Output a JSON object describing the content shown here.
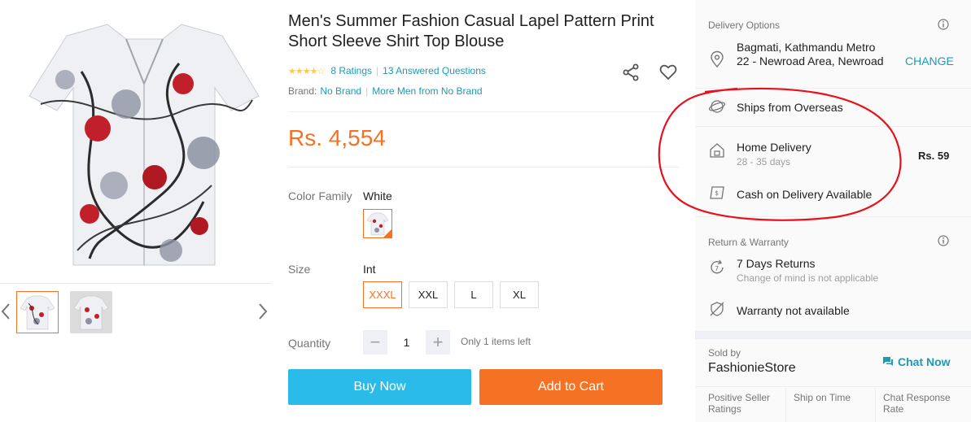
{
  "product": {
    "title": "Men's Summer Fashion Casual Lapel Pattern Print Short Sleeve Shirt Top Blouse",
    "ratings_count": "8 Ratings",
    "answered_questions": "13 Answered Questions",
    "brand_label": "Brand:",
    "brand_value": "No Brand",
    "more_from_brand": "More Men from No Brand",
    "price": "Rs. 4,554"
  },
  "options": {
    "color_label": "Color Family",
    "color_value": "White",
    "size_label": "Size",
    "size_value": "Int",
    "sizes": [
      "XXXL",
      "XXL",
      "L",
      "XL"
    ],
    "selected_size": "XXXL",
    "quantity_label": "Quantity",
    "quantity_value": "1",
    "stock_note": "Only 1 items left"
  },
  "actions": {
    "buy_now": "Buy Now",
    "add_to_cart": "Add to Cart"
  },
  "delivery": {
    "heading": "Delivery Options",
    "location": "Bagmati, Kathmandu Metro 22 - Newroad Area, Newroad",
    "change": "CHANGE",
    "ships_from": "Ships from Overseas",
    "home_delivery": "Home Delivery",
    "home_delivery_days": "28 - 35 days",
    "home_delivery_fee": "Rs. 59",
    "cod": "Cash on Delivery Available"
  },
  "warranty": {
    "heading": "Return & Warranty",
    "returns": "7 Days Returns",
    "returns_note": "Change of mind is not applicable",
    "warranty": "Warranty not available"
  },
  "seller": {
    "sold_by": "Sold by",
    "store_name": "FashionieStore",
    "chat": "Chat Now",
    "metric_1": "Positive Seller Ratings",
    "metric_2": "Ship on Time",
    "metric_3": "Chat Response Rate"
  },
  "colors": {
    "accent_orange": "#f57224",
    "buy_blue": "#2abbe8",
    "link_teal": "#1a9cb7",
    "highlight_red": "#e8101a"
  }
}
